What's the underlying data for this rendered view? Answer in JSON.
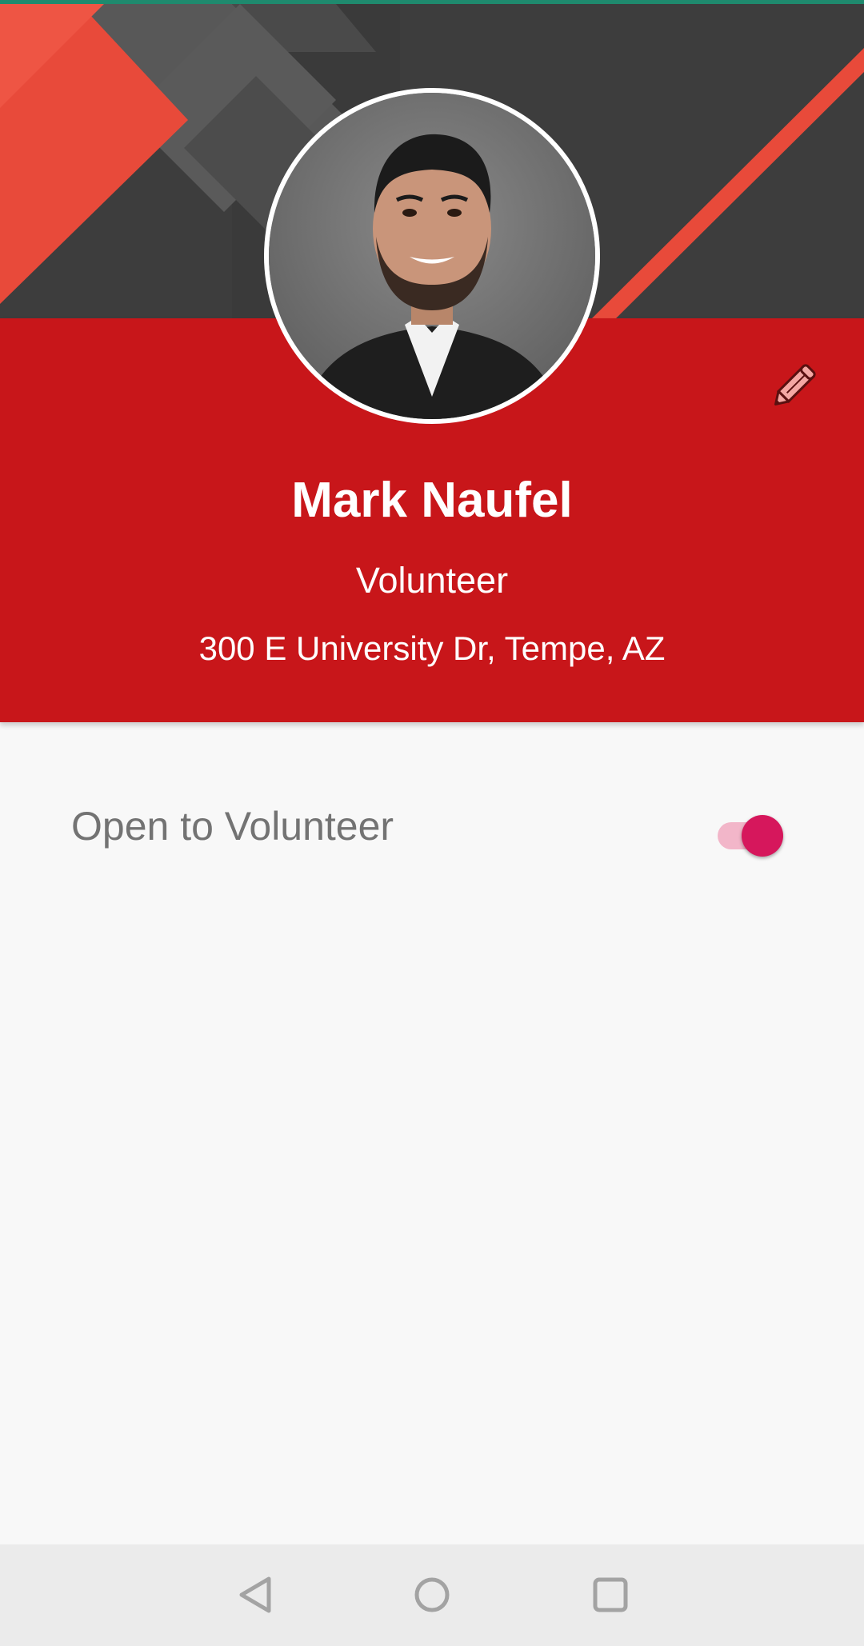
{
  "profile": {
    "name": "Mark Naufel",
    "role": "Volunteer",
    "address": "300 E University Dr, Tempe, AZ"
  },
  "settings": {
    "open_to_volunteer_label": "Open to Volunteer",
    "open_to_volunteer_enabled": true
  },
  "icons": {
    "edit": "pencil-icon",
    "back": "back-icon",
    "home": "home-icon",
    "recents": "recents-icon"
  },
  "colors": {
    "header_red": "#c8161a",
    "banner_dark": "#3d3d3d",
    "accent_red": "#e84a3a",
    "toggle_thumb": "#d6175c",
    "toggle_track": "#f2b6c9",
    "status_accent": "#1f8a6e"
  }
}
